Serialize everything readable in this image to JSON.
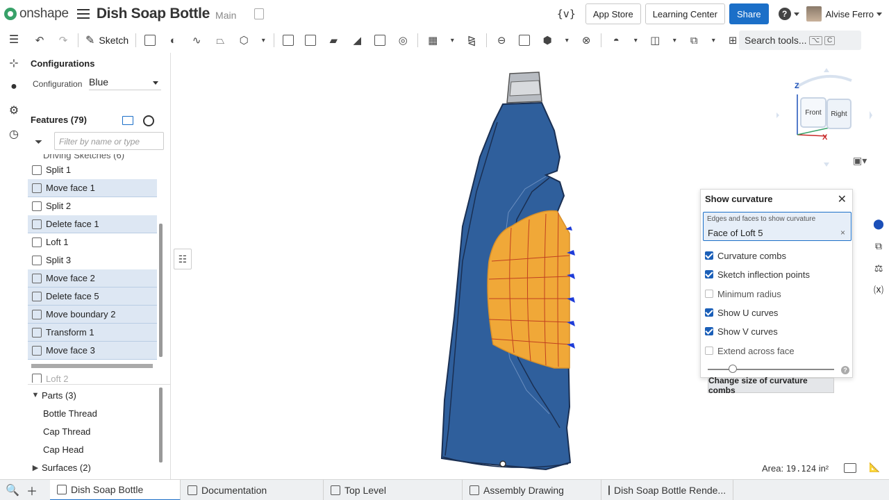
{
  "topbar": {
    "brand": "onshape",
    "document_title": "Dish Soap Bottle",
    "workspace": "Main",
    "variables_icon": "{v}",
    "app_store": "App Store",
    "learning_center": "Learning Center",
    "share": "Share",
    "help_icon": "?",
    "user_name": "Alvise Ferro"
  },
  "toolbar": {
    "sketch_label": "Sketch",
    "search_label": "Search tools...",
    "search_kbd1": "⌥",
    "search_kbd2": "C"
  },
  "configurations": {
    "title": "Configurations",
    "label": "Configuration",
    "value": "Blue"
  },
  "features": {
    "header": "Features (79)",
    "filter_placeholder": "Filter by name or type",
    "partial_top": "Driving Sketches (6)",
    "items": [
      {
        "label": "Split 1",
        "selected": false
      },
      {
        "label": "Move face 1",
        "selected": true
      },
      {
        "label": "Split 2",
        "selected": false
      },
      {
        "label": "Delete face 1",
        "selected": true
      },
      {
        "label": "Loft 1",
        "selected": false
      },
      {
        "label": "Split 3",
        "selected": false
      },
      {
        "label": "Move face 2",
        "selected": true
      },
      {
        "label": "Delete face 5",
        "selected": true
      },
      {
        "label": "Move boundary 2",
        "selected": true
      },
      {
        "label": "Transform 1",
        "selected": true
      },
      {
        "label": "Move face 3",
        "selected": true
      }
    ],
    "partial_bottom": "Loft 2"
  },
  "parts": {
    "header": "Parts (3)",
    "items": [
      "Bottle Thread",
      "Cap Thread",
      "Cap Head"
    ],
    "surfaces": "Surfaces (2)"
  },
  "viewcube": {
    "front": "Front",
    "right": "Right",
    "z": "Z",
    "x": "X"
  },
  "curvature": {
    "title": "Show curvature",
    "field_label": "Edges and faces to show curvature",
    "field_value": "Face of Loft 5",
    "options": [
      {
        "label": "Curvature combs",
        "checked": true
      },
      {
        "label": "Sketch inflection points",
        "checked": true
      },
      {
        "label": "Minimum radius",
        "checked": false
      },
      {
        "label": "Show U curves",
        "checked": true
      },
      {
        "label": "Show V curves",
        "checked": true
      },
      {
        "label": "Extend across face",
        "checked": false
      }
    ],
    "tooltip": "Change size of curvature combs",
    "help": "?"
  },
  "area": {
    "label": "Area:",
    "value": "19.124",
    "unit": "in²"
  },
  "tabs": [
    {
      "label": "Dish Soap Bottle",
      "active": true
    },
    {
      "label": "Documentation",
      "active": false
    },
    {
      "label": "Top Level",
      "active": false
    },
    {
      "label": "Assembly Drawing",
      "active": false
    },
    {
      "label": "Dish Soap Bottle Rende...",
      "active": false
    }
  ],
  "colors": {
    "accent": "#1b6fc8",
    "bottle_body": "#2f5f9c",
    "face_highlight": "#f0a838"
  }
}
